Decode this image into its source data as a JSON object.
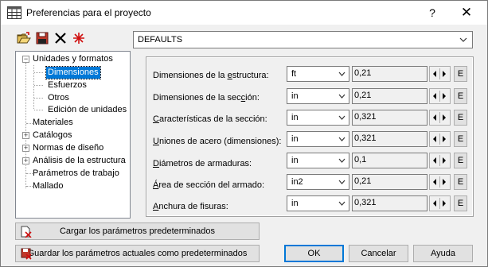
{
  "window": {
    "title": "Preferencias para el proyecto",
    "help_label": "?",
    "close_label": "✕"
  },
  "toolbar": {
    "icons": [
      "open-folder-icon",
      "save-icon",
      "delete-icon",
      "reset-icon"
    ],
    "preset_value": "DEFAULTS"
  },
  "tree": {
    "items": [
      {
        "label": "Unidades y formatos",
        "expander": "−"
      },
      {
        "label": "Dimensiones",
        "selected": true
      },
      {
        "label": "Esfuerzos"
      },
      {
        "label": "Otros"
      },
      {
        "label": "Edición de unidades"
      },
      {
        "label": "Materiales"
      },
      {
        "label": "Catálogos",
        "expander": "+"
      },
      {
        "label": "Normas de diseño",
        "expander": "+"
      },
      {
        "label": "Análisis de la estructura",
        "expander": "+"
      },
      {
        "label": "Parámetros de trabajo"
      },
      {
        "label": "Mallado"
      }
    ]
  },
  "dimensions": {
    "rows": [
      {
        "label_pre": "Dimensiones de la ",
        "label_u": "e",
        "label_post": "structura:",
        "unit": "ft",
        "precision": "0,21",
        "e": "E"
      },
      {
        "label_pre": "Dimensiones de la sec",
        "label_u": "c",
        "label_post": "ión:",
        "unit": "in",
        "precision": "0,21",
        "e": "E"
      },
      {
        "label_pre": "",
        "label_u": "C",
        "label_post": "aracterísticas de la sección:",
        "unit": "in",
        "precision": "0,321",
        "e": "E"
      },
      {
        "label_pre": "",
        "label_u": "U",
        "label_post": "niones de acero (dimensiones):",
        "unit": "in",
        "precision": "0,321",
        "e": "E"
      },
      {
        "label_pre": "",
        "label_u": "D",
        "label_post": "iámetros de armaduras:",
        "unit": "in",
        "precision": "0,1",
        "e": "E"
      },
      {
        "label_pre": "",
        "label_u": "Á",
        "label_post": "rea de sección del armado:",
        "unit": "in2",
        "precision": "0,21",
        "e": "E"
      },
      {
        "label_pre": "",
        "label_u": "A",
        "label_post": "nchura de fisuras:",
        "unit": "in",
        "precision": "0,321",
        "e": "E"
      }
    ]
  },
  "buttons": {
    "load_defaults": "Cargar los parámetros predeterminados",
    "save_defaults": "Guardar los parámetros actuales como predeterminados",
    "ok": "OK",
    "cancel": "Cancelar",
    "help": "Ayuda"
  }
}
